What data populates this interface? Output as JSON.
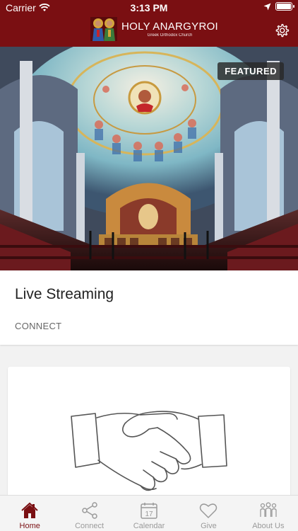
{
  "status_bar": {
    "carrier": "Carrier",
    "time": "3:13 PM"
  },
  "header": {
    "title": "HOLY ANARGYROI",
    "subtitle": "Greek Orthodox Church"
  },
  "featured": {
    "badge": "FEATURED"
  },
  "card": {
    "title": "Live Streaming",
    "subtitle": "CONNECT"
  },
  "tabs": [
    {
      "label": "Home",
      "icon": "home-icon",
      "active": true
    },
    {
      "label": "Connect",
      "icon": "share-icon",
      "active": false
    },
    {
      "label": "Calendar",
      "icon": "calendar-icon",
      "active": false
    },
    {
      "label": "Give",
      "icon": "heart-icon",
      "active": false
    },
    {
      "label": "About Us",
      "icon": "people-icon",
      "active": false
    }
  ],
  "colors": {
    "brand": "#7a0f12",
    "tab_inactive": "#9a9a9a"
  }
}
